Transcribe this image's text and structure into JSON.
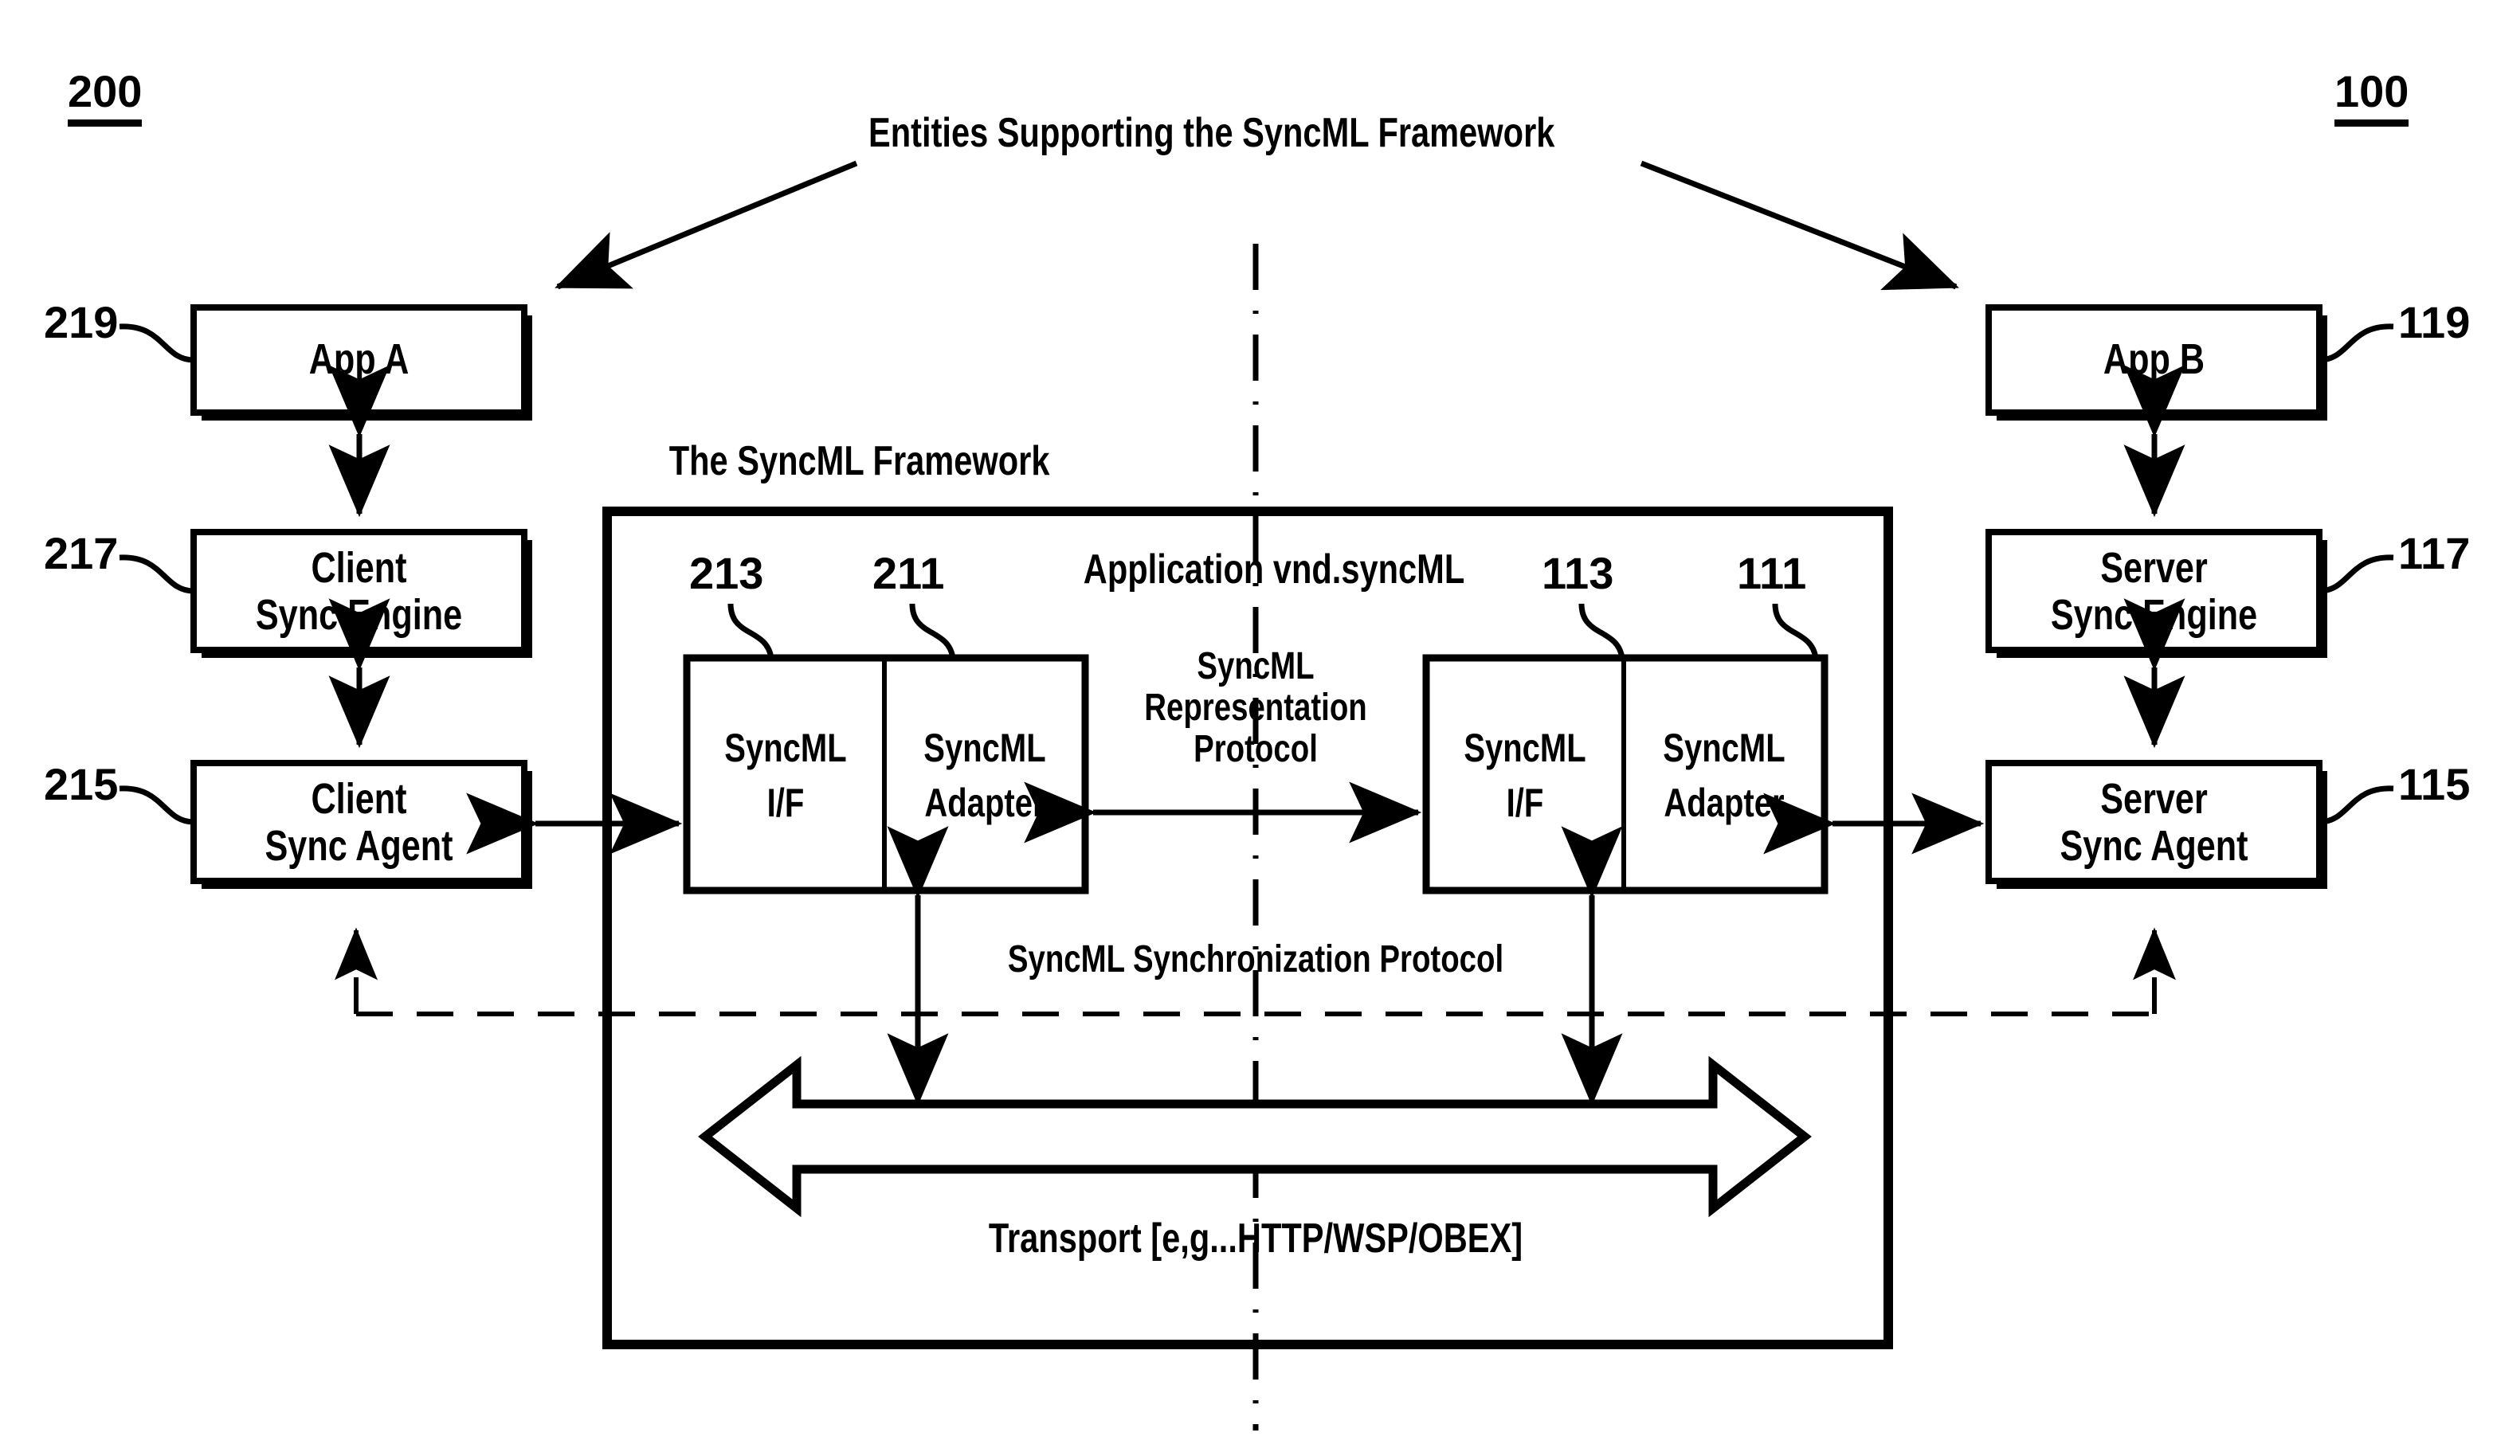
{
  "figure": {
    "title": "Entities Supporting the SyncML Framework",
    "framework_label": "The SyncML Framework",
    "application_label": "Application vnd.syncML",
    "representation_protocol": [
      "SyncML",
      "Representation",
      "Protocol"
    ],
    "synchronization_protocol": "SyncML Synchronization Protocol",
    "transport_label": "Transport [e,g...HTTP/WSP/OBEX]"
  },
  "reference_numerals": {
    "client_system": "200",
    "server_system": "100",
    "app_a": "219",
    "client_sync_engine": "217",
    "client_sync_agent": "215",
    "app_b": "119",
    "server_sync_engine": "117",
    "server_sync_agent": "115",
    "client_syncml_if": "213",
    "client_syncml_adapter": "211",
    "server_syncml_if": "113",
    "server_syncml_adapter": "111"
  },
  "client_side": {
    "app": "App A",
    "sync_engine": [
      "Client",
      "Sync Engine"
    ],
    "sync_agent": [
      "Client",
      "Sync Agent"
    ],
    "syncml_if": [
      "SyncML",
      "I/F"
    ],
    "syncml_adapter": [
      "SyncML",
      "Adapter"
    ]
  },
  "server_side": {
    "app": "App B",
    "sync_engine": [
      "Server",
      "Sync Engine"
    ],
    "sync_agent": [
      "Server",
      "Sync Agent"
    ],
    "syncml_if": [
      "SyncML",
      "I/F"
    ],
    "syncml_adapter": [
      "SyncML",
      "Adapter"
    ]
  },
  "colors": {
    "stroke": "#000000",
    "background": "#ffffff"
  }
}
